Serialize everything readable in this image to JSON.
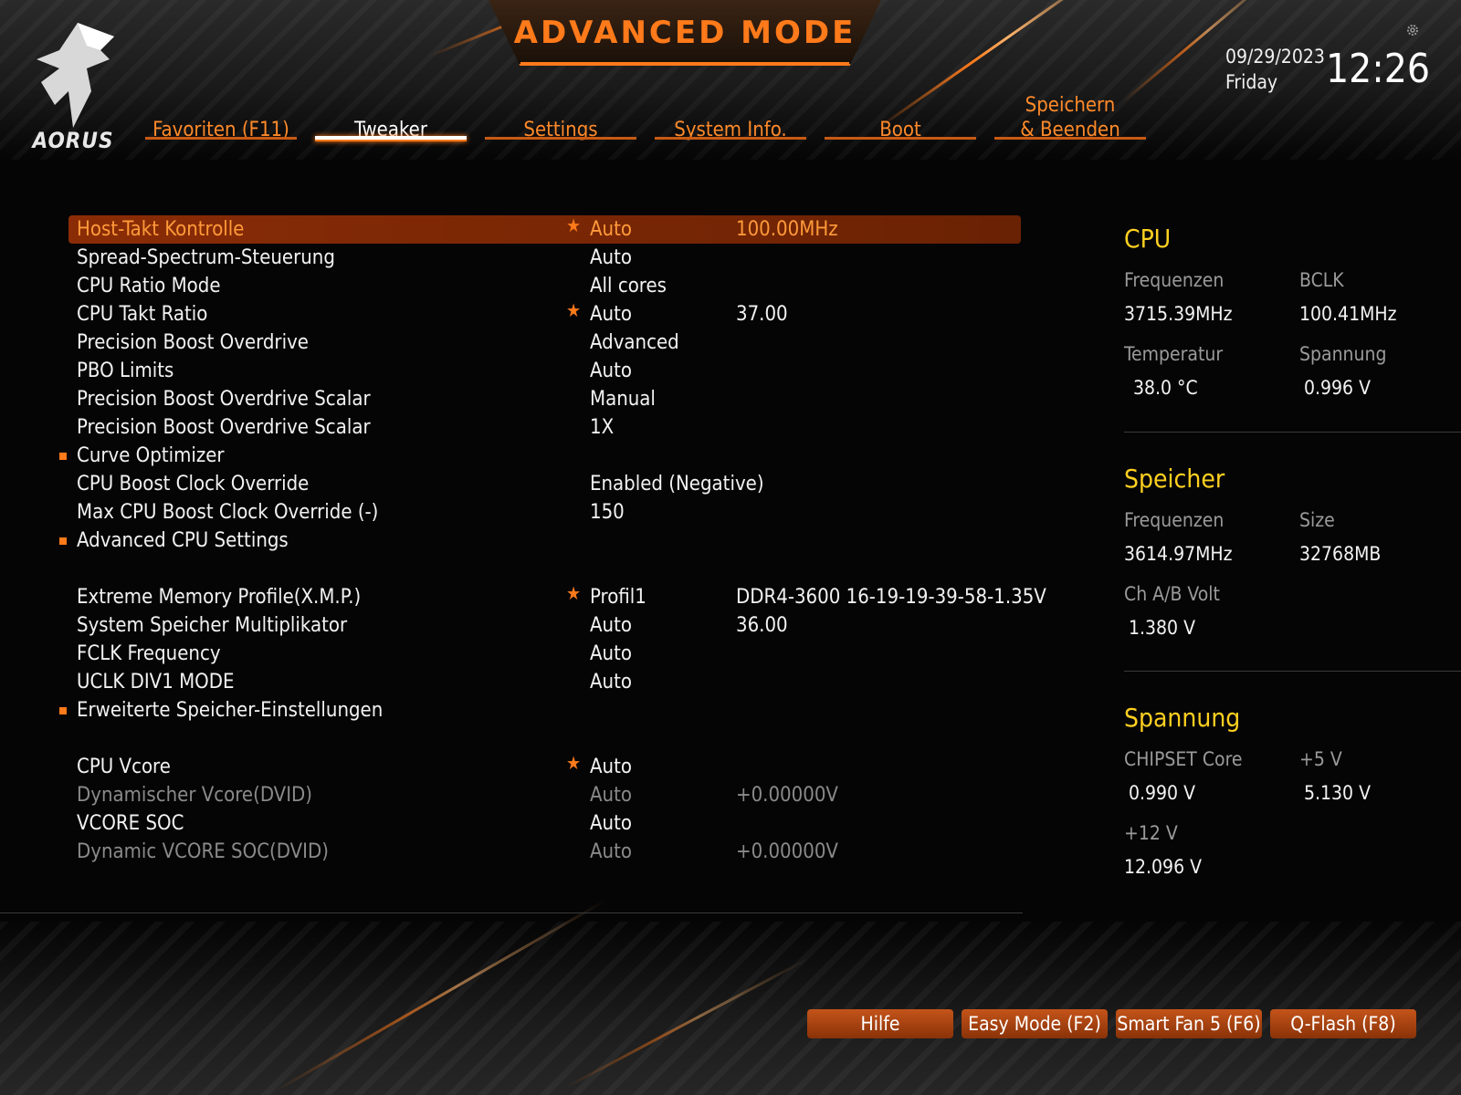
{
  "header": {
    "title": "ADVANCED MODE",
    "brand": "AORUS",
    "date": "09/29/2023",
    "day": "Friday",
    "time": "12:26",
    "accent_color": "#ff7a1a"
  },
  "tabs": [
    {
      "label": "Favoriten (F11)",
      "active": false
    },
    {
      "label": "Tweaker",
      "active": true
    },
    {
      "label": "Settings",
      "active": false
    },
    {
      "label": "System Info.",
      "active": false
    },
    {
      "label": "Boot",
      "active": false
    },
    {
      "label": "Speichern\n& Beenden",
      "active": false
    }
  ],
  "settings": [
    {
      "label": "Host-Takt Kontrolle",
      "value": "Auto",
      "current": "100.00MHz",
      "starred": true,
      "selected": true
    },
    {
      "label": "Spread-Spectrum-Steuerung",
      "value": "Auto",
      "current": ""
    },
    {
      "label": "CPU Ratio Mode",
      "value": "All cores",
      "current": ""
    },
    {
      "label": "CPU Takt Ratio",
      "value": "Auto",
      "current": "37.00",
      "starred": true
    },
    {
      "label": "Precision Boost Overdrive",
      "value": "Advanced",
      "current": ""
    },
    {
      "label": "PBO Limits",
      "value": "Auto",
      "current": ""
    },
    {
      "label": "Precision Boost Overdrive Scalar",
      "value": "Manual",
      "current": ""
    },
    {
      "label": "Precision Boost Overdrive Scalar",
      "value": "1X",
      "current": ""
    },
    {
      "label": "Curve Optimizer",
      "value": "",
      "current": "",
      "submenu": true
    },
    {
      "label": "CPU Boost Clock Override",
      "value": "Enabled (Negative)",
      "current": ""
    },
    {
      "label": "Max CPU Boost Clock Override (-)",
      "value": "150",
      "current": ""
    },
    {
      "label": "Advanced CPU Settings",
      "value": "",
      "current": "",
      "submenu": true
    },
    {
      "label": "Extreme Memory Profile(X.M.P.)",
      "value": "Profil1",
      "current": "DDR4-3600 16-19-19-39-58-1.35V",
      "starred": true
    },
    {
      "label": "System Speicher Multiplikator",
      "value": "Auto",
      "current": "36.00"
    },
    {
      "label": "FCLK Frequency",
      "value": "Auto",
      "current": ""
    },
    {
      "label": "UCLK DIV1 MODE",
      "value": "Auto",
      "current": ""
    },
    {
      "label": "Erweiterte Speicher-Einstellungen",
      "value": "",
      "current": "",
      "submenu": true
    },
    {
      "label": "CPU Vcore",
      "value": "Auto",
      "current": "",
      "starred": true
    },
    {
      "label": "Dynamischer Vcore(DVID)",
      "value": "Auto",
      "current": "+0.00000V",
      "disabled": true
    },
    {
      "label": "VCORE SOC",
      "value": "Auto",
      "current": ""
    },
    {
      "label": "Dynamic VCORE SOC(DVID)",
      "value": "Auto",
      "current": "+0.00000V",
      "disabled": true
    }
  ],
  "sidebar": {
    "cpu": {
      "title": "CPU",
      "freq_label": "Frequenzen",
      "freq_value": "3715.39MHz",
      "bclk_label": "BCLK",
      "bclk_value": "100.41MHz",
      "temp_label": "Temperatur",
      "temp_value": "38.0 °C",
      "volt_label": "Spannung",
      "volt_value": "0.996 V"
    },
    "memory": {
      "title": "Speicher",
      "freq_label": "Frequenzen",
      "freq_value": "3614.97MHz",
      "size_label": "Size",
      "size_value": "32768MB",
      "volt_label": "Ch A/B Volt",
      "volt_value": "1.380 V"
    },
    "voltage": {
      "title": "Spannung",
      "chipset_label": "CHIPSET Core",
      "chipset_value": "0.990 V",
      "p5_label": "+5 V",
      "p5_value": "5.130 V",
      "p12_label": "+12 V",
      "p12_value": "12.096 V"
    }
  },
  "footer": {
    "buttons": [
      "Hilfe",
      "Easy Mode (F2)",
      "Smart Fan 5 (F6)",
      "Q-Flash (F8)"
    ]
  }
}
